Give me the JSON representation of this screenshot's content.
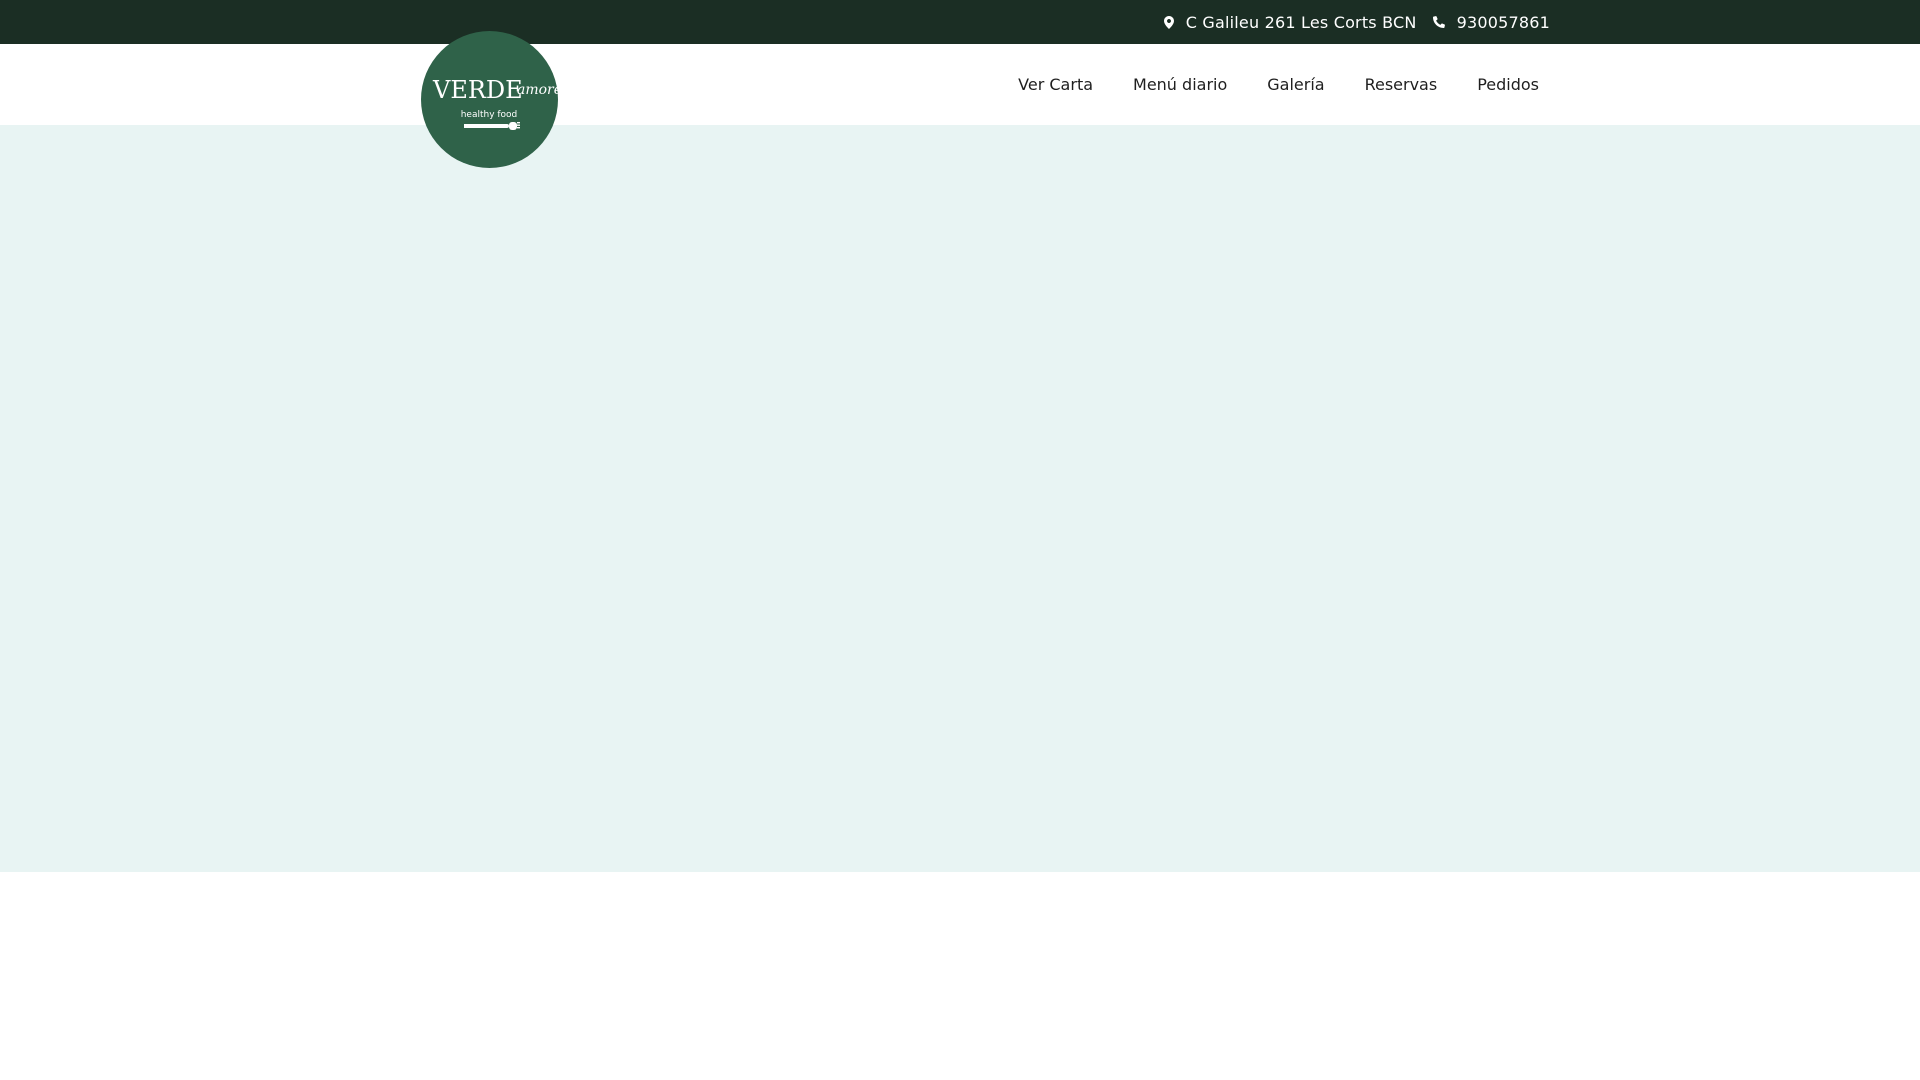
{
  "topbar": {
    "address": "C Galileu 261 Les Corts BCN",
    "address_icon": "map-marker-icon",
    "phone": "930057861",
    "phone_icon": "phone-icon"
  },
  "logo": {
    "brand": "VERDE amore",
    "tagline": "healthy food",
    "icon": "fork-icon"
  },
  "nav": {
    "items": [
      {
        "label": "Ver Carta"
      },
      {
        "label": "Menú diario"
      },
      {
        "label": "Galería"
      },
      {
        "label": "Reservas"
      },
      {
        "label": "Pedidos"
      }
    ]
  },
  "colors": {
    "topbar_bg": "#1b2e24",
    "logo_bg": "#2f6249",
    "hero_bg": "#e8f4f3",
    "nav_text": "#1f1f1f"
  }
}
